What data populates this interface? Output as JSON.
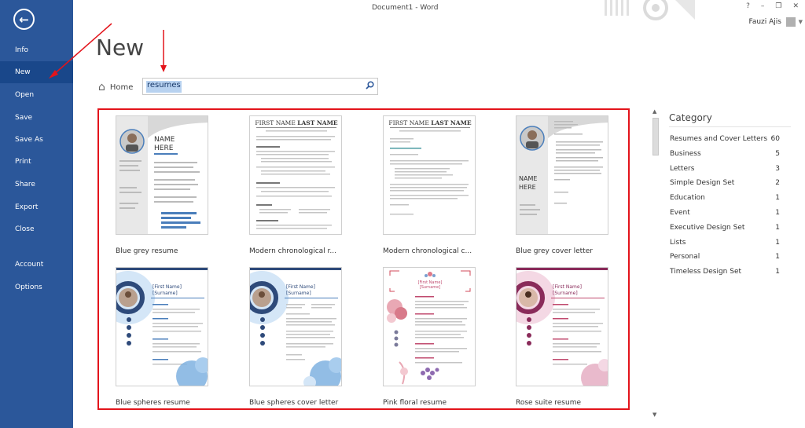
{
  "window": {
    "title": "Document1 - Word",
    "help": "?",
    "minimize": "–",
    "restore": "❐",
    "close": "✕",
    "user": "Fauzi Ajis"
  },
  "sidebar": {
    "back": "←",
    "items": [
      {
        "label": "Info"
      },
      {
        "label": "New"
      },
      {
        "label": "Open"
      },
      {
        "label": "Save"
      },
      {
        "label": "Save As"
      },
      {
        "label": "Print"
      },
      {
        "label": "Share"
      },
      {
        "label": "Export"
      },
      {
        "label": "Close"
      },
      {
        "label": "Account"
      },
      {
        "label": "Options"
      }
    ]
  },
  "main": {
    "title": "New",
    "home": "Home",
    "search_value": "resumes",
    "templates": [
      {
        "label": "Blue grey resume",
        "name_text": "NAME HERE",
        "subtitle": "JOB TITLE HERE"
      },
      {
        "label": "Modern chronological r...",
        "name_text": "FIRST NAME LAST NAME"
      },
      {
        "label": "Modern chronological c...",
        "name_text": "FIRST NAME LAST NAME"
      },
      {
        "label": "Blue grey cover letter",
        "name_text": "NAME HERE",
        "subtitle": "JOB TITLE HERE"
      },
      {
        "label": "Blue spheres resume",
        "name_text": "[First Name] [Surname]"
      },
      {
        "label": "Blue spheres cover letter",
        "name_text": "[First Name] [Surname]"
      },
      {
        "label": "Pink floral resume",
        "name_text": "[First Name] [Surname]"
      },
      {
        "label": "Rose suite resume",
        "name_text": "[First Name] [Surname]"
      }
    ]
  },
  "category": {
    "title": "Category",
    "items": [
      {
        "label": "Resumes and Cover Letters",
        "count": "60"
      },
      {
        "label": "Business",
        "count": "5"
      },
      {
        "label": "Letters",
        "count": "3"
      },
      {
        "label": "Simple Design Set",
        "count": "2"
      },
      {
        "label": "Education",
        "count": "1"
      },
      {
        "label": "Event",
        "count": "1"
      },
      {
        "label": "Executive Design Set",
        "count": "1"
      },
      {
        "label": "Lists",
        "count": "1"
      },
      {
        "label": "Personal",
        "count": "1"
      },
      {
        "label": "Timeless Design Set",
        "count": "1"
      }
    ]
  },
  "colors": {
    "sidebar": "#2b579a",
    "annotation": "#e3141b",
    "blue_accent": "#4a7ebb",
    "pink_accent": "#c04a6e"
  }
}
